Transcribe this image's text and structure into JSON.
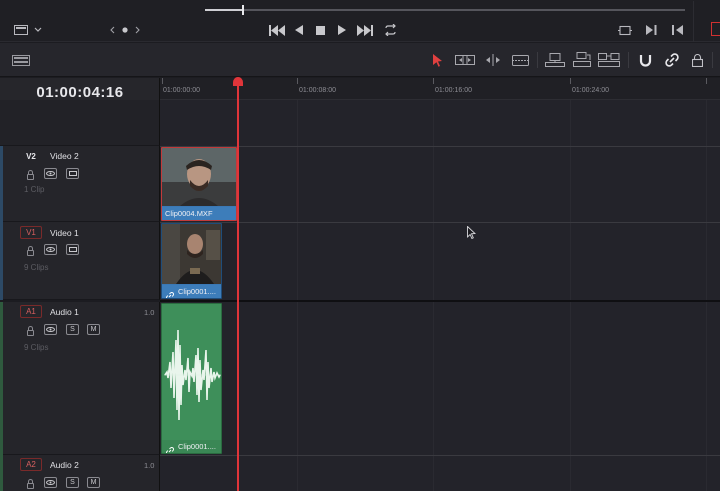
{
  "timecode": "01:00:04:16",
  "ruler": {
    "ticks": [
      "01:00:00:00",
      "01:00:08:00",
      "01:00:16:00",
      "01:00:24:00"
    ]
  },
  "tracks": {
    "v2": {
      "tag": "V2",
      "name": "Video 2",
      "count": "1 Clip"
    },
    "v1": {
      "tag": "V1",
      "name": "Video 1",
      "count": "9 Clips"
    },
    "a1": {
      "tag": "A1",
      "name": "Audio 1",
      "count": "9 Clips",
      "level": "1.0",
      "solo": "S",
      "mute": "M"
    },
    "a2": {
      "tag": "A2",
      "name": "Audio 2",
      "level": "1.0",
      "solo": "S",
      "mute": "M"
    }
  },
  "clips": {
    "v2_clip": "Clip0004.MXF",
    "v1_clip": "Clip0001....",
    "a1_clip": "Clip0001...."
  },
  "icons": {
    "viewer_menu": "monitor-icon",
    "page_dots": "page-dots-icon",
    "skip_back": "skip-back-icon",
    "play_reverse": "play-reverse-icon",
    "stop": "stop-icon",
    "play": "play-icon",
    "skip_forward": "skip-forward-icon",
    "loop": "loop-icon"
  },
  "colors": {
    "playhead": "#e0353a",
    "video_clip": "#3a78b5",
    "audio_clip": "#3e8f5a"
  }
}
